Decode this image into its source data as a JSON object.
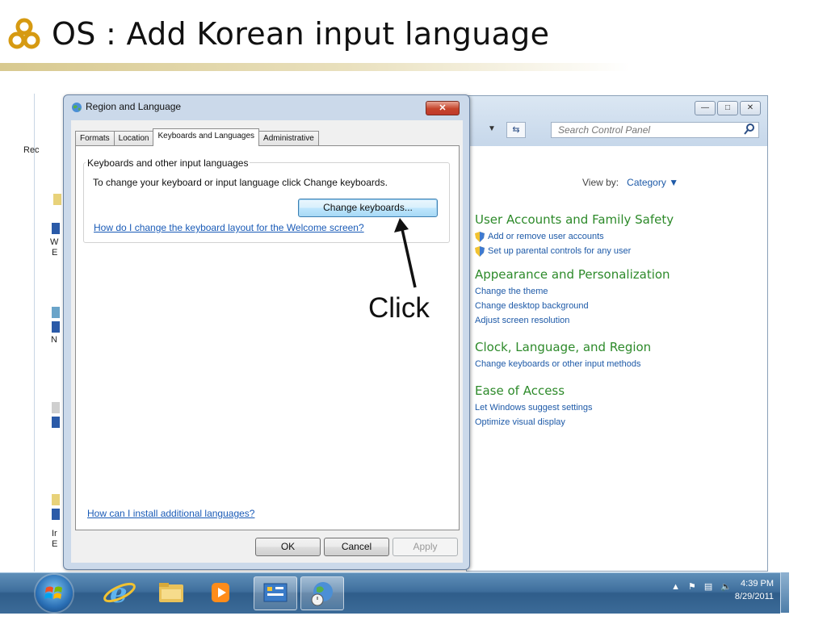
{
  "slide": {
    "title": "OS : Add Korean input language"
  },
  "desktop": {
    "fragments": [
      "Rec",
      "W",
      "E",
      "N",
      "Ir",
      "E"
    ]
  },
  "control_panel": {
    "search_placeholder": "Search Control Panel",
    "view_by_label": "View by:",
    "view_by_value": "Category",
    "sections": [
      {
        "heading": "User Accounts and Family Safety",
        "links": [
          "Add or remove user accounts",
          "Set up parental controls for any user"
        ]
      },
      {
        "heading": "Appearance and Personalization",
        "links": [
          "Change the theme",
          "Change desktop background",
          "Adjust screen resolution"
        ]
      },
      {
        "heading": "Clock, Language, and Region",
        "links": [
          "Change keyboards or other input methods"
        ]
      },
      {
        "heading": "Ease of Access",
        "links": [
          "Let Windows suggest settings",
          "Optimize visual display"
        ]
      }
    ]
  },
  "dialog": {
    "title": "Region and Language",
    "tabs": [
      "Formats",
      "Location",
      "Keyboards and Languages",
      "Administrative"
    ],
    "active_tab": "Keyboards and Languages",
    "group_legend": "Keyboards and other input languages",
    "group_description": "To change your keyboard or input language click Change keyboards.",
    "change_keyboards_button": "Change keyboards...",
    "welcome_link": "How do I change the keyboard layout for the Welcome screen?",
    "install_link": "How can I install additional languages?",
    "ok_button": "OK",
    "cancel_button": "Cancel",
    "apply_button": "Apply"
  },
  "annotation": {
    "text": "Click"
  },
  "taskbar": {
    "time": "4:39 PM",
    "date": "8/29/2011"
  }
}
